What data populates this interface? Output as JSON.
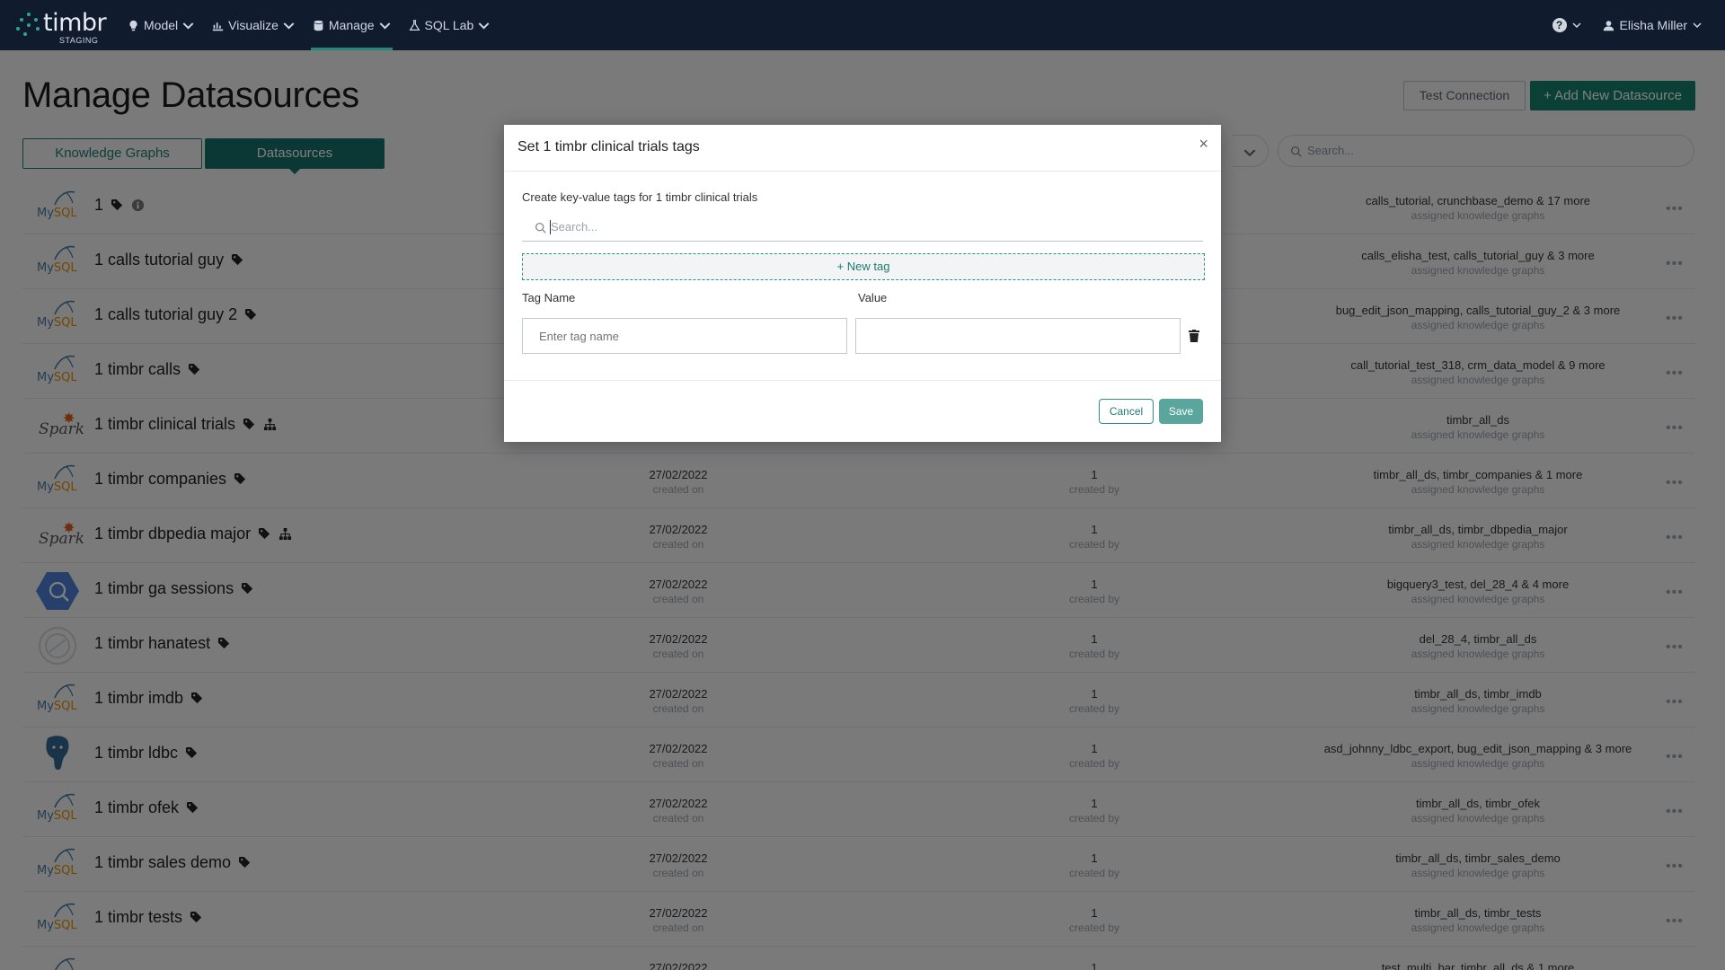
{
  "navbar": {
    "brand": "timbr",
    "environment": "STAGING",
    "items": [
      {
        "label": "Model",
        "icon": "lightbulb-icon"
      },
      {
        "label": "Visualize",
        "icon": "chart-icon"
      },
      {
        "label": "Manage",
        "icon": "database-icon",
        "active": true
      },
      {
        "label": "SQL Lab",
        "icon": "flask-icon"
      }
    ],
    "help_icon": "?",
    "user_name": "Elisha Miller"
  },
  "page": {
    "title": "Manage Datasources",
    "test_connection_label": "Test Connection",
    "add_datasource_label": "+ Add New Datasource",
    "tabs": [
      "Knowledge Graphs",
      "Datasources"
    ],
    "active_tab": "Datasources",
    "search_placeholder": "Search..."
  },
  "table": {
    "sub_created_on": "created on",
    "sub_created_by": "created by",
    "sub_assigned": "assigned knowledge graphs",
    "rows": [
      {
        "icon": "mysql",
        "name": "1",
        "date": "",
        "creator": "",
        "kgs": "calls_tutorial, crunchbase_demo & 17 more",
        "info": true
      },
      {
        "icon": "mysql",
        "name": "1 calls tutorial guy",
        "date": "",
        "creator": "",
        "kgs": "calls_elisha_test, calls_tutorial_guy & 3 more"
      },
      {
        "icon": "mysql",
        "name": "1 calls tutorial guy 2",
        "date": "",
        "creator": "",
        "kgs": "bug_edit_json_mapping, calls_tutorial_guy_2 & 3 more"
      },
      {
        "icon": "mysql",
        "name": "1 timbr calls",
        "date": "",
        "creator": "",
        "kgs": "call_tutorial_test_318, crm_data_model & 9 more"
      },
      {
        "icon": "spark",
        "name": "1 timbr clinical trials",
        "date": "",
        "creator": "",
        "kgs": "timbr_all_ds",
        "hierarchy": true
      },
      {
        "icon": "mysql",
        "name": "1 timbr companies",
        "date": "27/02/2022",
        "creator": "1",
        "kgs": "timbr_all_ds, timbr_companies & 1 more"
      },
      {
        "icon": "spark",
        "name": "1 timbr dbpedia major",
        "date": "27/02/2022",
        "creator": "1",
        "kgs": "timbr_all_ds, timbr_dbpedia_major",
        "hierarchy": true
      },
      {
        "icon": "bigquery",
        "name": "1 timbr ga sessions",
        "date": "27/02/2022",
        "creator": "1",
        "kgs": "bigquery3_test, del_28_4 & 4 more"
      },
      {
        "icon": "hana",
        "name": "1 timbr hanatest",
        "date": "27/02/2022",
        "creator": "1",
        "kgs": "del_28_4, timbr_all_ds"
      },
      {
        "icon": "mysql",
        "name": "1 timbr imdb",
        "date": "27/02/2022",
        "creator": "1",
        "kgs": "timbr_all_ds, timbr_imdb"
      },
      {
        "icon": "postgres",
        "name": "1 timbr ldbc",
        "date": "27/02/2022",
        "creator": "1",
        "kgs": "asd_johnny_ldbc_export, bug_edit_json_mapping & 3 more"
      },
      {
        "icon": "mysql",
        "name": "1 timbr ofek",
        "date": "27/02/2022",
        "creator": "1",
        "kgs": "timbr_all_ds, timbr_ofek"
      },
      {
        "icon": "mysql",
        "name": "1 timbr sales demo",
        "date": "27/02/2022",
        "creator": "1",
        "kgs": "timbr_all_ds, timbr_sales_demo"
      },
      {
        "icon": "mysql",
        "name": "1 timbr tests",
        "date": "27/02/2022",
        "creator": "1",
        "kgs": "timbr_all_ds, timbr_tests"
      },
      {
        "icon": "mysql",
        "name": "",
        "date": "27/02/2022",
        "creator": "1",
        "kgs": "test_multi_bar, timbr_all_ds & 1 more"
      }
    ]
  },
  "modal": {
    "title": "Set 1 timbr clinical trials tags",
    "description": "Create key-value tags for 1 timbr clinical trials",
    "search_placeholder": "Search...",
    "new_tag_label": "+ New tag",
    "tag_name_label": "Tag Name",
    "value_label": "Value",
    "tag_name_placeholder": "Enter tag name",
    "value_input": "",
    "cancel_label": "Cancel",
    "save_label": "Save",
    "close_symbol": "×"
  },
  "colors": {
    "navbar_bg": "#101b2d",
    "accent": "#17806f",
    "save_button": "#5aa59c"
  }
}
